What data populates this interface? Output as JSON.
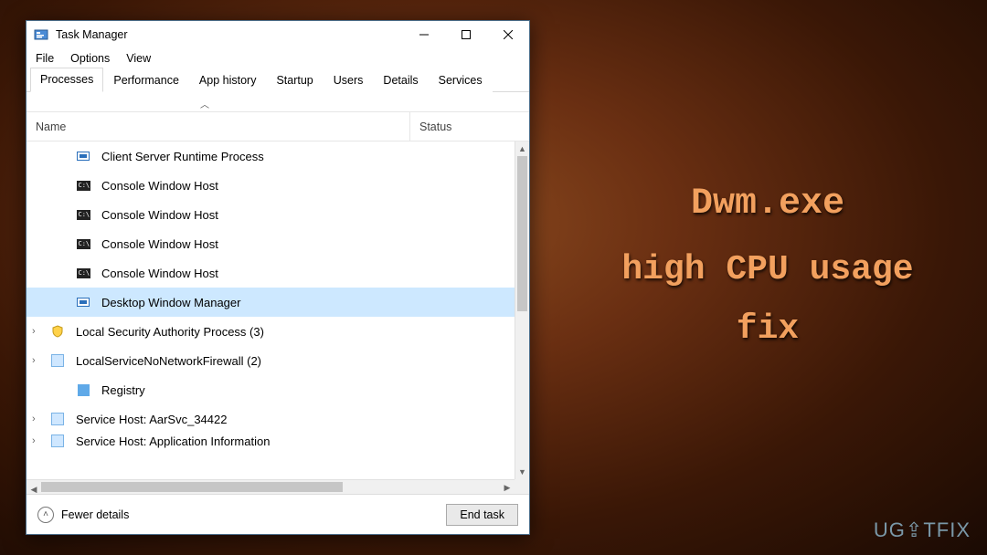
{
  "promo": {
    "line1": "Dwm.exe",
    "line2": "high CPU usage",
    "line3": "fix"
  },
  "watermark": "UG⇪TFIX",
  "window": {
    "title": "Task Manager",
    "menu": [
      "File",
      "Options",
      "View"
    ],
    "tabs": [
      "Processes",
      "Performance",
      "App history",
      "Startup",
      "Users",
      "Details",
      "Services"
    ],
    "active_tab": 0,
    "columns": {
      "name": "Name",
      "status": "Status"
    },
    "rows": [
      {
        "icon": "box",
        "label": "Client Server Runtime Process",
        "child": true
      },
      {
        "icon": "console",
        "label": "Console Window Host",
        "child": true
      },
      {
        "icon": "console",
        "label": "Console Window Host",
        "child": true
      },
      {
        "icon": "console",
        "label": "Console Window Host",
        "child": true
      },
      {
        "icon": "console",
        "label": "Console Window Host",
        "child": true
      },
      {
        "icon": "box",
        "label": "Desktop Window Manager",
        "child": true,
        "selected": true
      },
      {
        "icon": "shield",
        "label": "Local Security Authority Process (3)",
        "expander": true
      },
      {
        "icon": "gear",
        "label": "LocalServiceNoNetworkFirewall (2)",
        "expander": true
      },
      {
        "icon": "reg",
        "label": "Registry",
        "child": true
      },
      {
        "icon": "gear",
        "label": "Service Host: AarSvc_34422",
        "expander": true
      },
      {
        "icon": "gear",
        "label": "Service Host: Application Information",
        "expander": true,
        "cut": true
      }
    ],
    "footer": {
      "fewer": "Fewer details",
      "endtask": "End task"
    }
  }
}
